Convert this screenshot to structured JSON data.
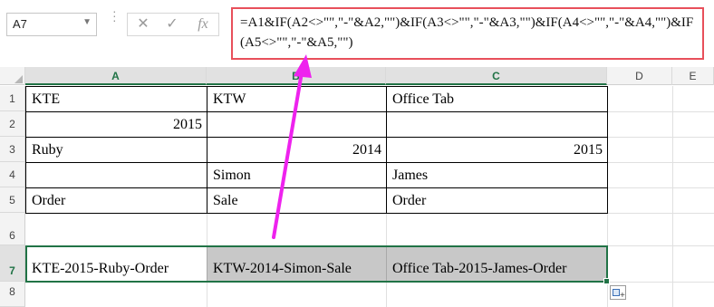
{
  "name_box": {
    "value": "A7",
    "dropdown_icon": "chevron-down-icon"
  },
  "formula_bar": {
    "cancel_icon": "close-icon",
    "enter_icon": "check-icon",
    "fx_label": "fx",
    "formula": "=A1&IF(A2<>\"\",\"-\"&A2,\"\")&IF(A3<>\"\",\"-\"&A3,\"\")&IF(A4<>\"\",\"-\"&A4,\"\")&IF(A5<>\"\",\"-\"&A5,\"\")"
  },
  "columns": [
    "A",
    "B",
    "C",
    "D",
    "E"
  ],
  "rows": [
    "1",
    "2",
    "3",
    "4",
    "5",
    "6",
    "7",
    "8"
  ],
  "cells": {
    "A1": "KTE",
    "B1": "KTW",
    "C1": "Office Tab",
    "A2": "2015",
    "A3": "Ruby",
    "B3": "2014",
    "C3": "2015",
    "B4": "Simon",
    "C4": "James",
    "A5": "Order",
    "B5": "Sale",
    "C5": "Order",
    "A7": "KTE-2015-Ruby-Order",
    "B7": "KTW-2014-Simon-Sale",
    "C7": "Office Tab-2015-James-Order"
  },
  "selection": {
    "active_cell": "A7",
    "range": "A7:C7"
  },
  "colors": {
    "accent": "#217346",
    "annotation": "#ee22ee",
    "formula_highlight": "#e8505b",
    "selected_fill": "#c8c8c8"
  },
  "paste_options_icon": "paste-options-icon"
}
